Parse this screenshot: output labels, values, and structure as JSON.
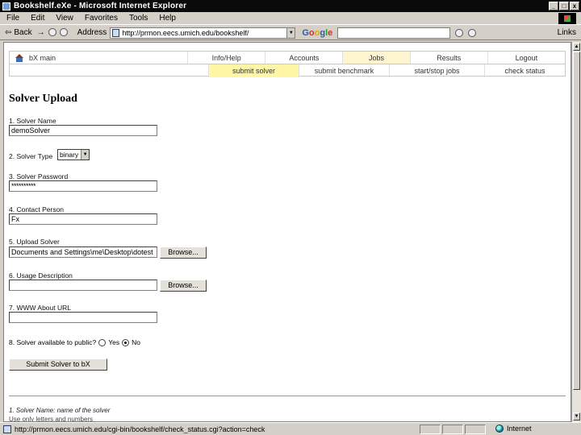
{
  "window": {
    "title": "Bookshelf.eXe - Microsoft Internet Explorer",
    "buttons": [
      "_",
      "□",
      "x"
    ]
  },
  "menubar": [
    "File",
    "Edit",
    "View",
    "Favorites",
    "Tools",
    "Help"
  ],
  "toolbar": {
    "back_label": "Back",
    "address_label": "Address",
    "address_value": "http://prmon.eecs.umich.edu/bookshelf/",
    "search_brand": "Google",
    "links_label": "Links"
  },
  "nav": {
    "home_label": "bX  main",
    "top_items": [
      "Info/Help",
      "Accounts",
      "Jobs",
      "Results",
      "Logout"
    ],
    "active_top": "Jobs",
    "sub_items": [
      "submit solver",
      "submit benchmark",
      "start/stop jobs",
      "check status"
    ],
    "active_sub": "submit solver"
  },
  "form": {
    "title": "Solver Upload",
    "fields": {
      "name_label": "1. Solver Name",
      "name_value": "demoSolver",
      "type_label": "2. Solver Type",
      "type_value": "binary",
      "password_label": "3. Solver Password",
      "password_value": "**********",
      "contact_label": "4. Contact Person",
      "contact_value": "Fx",
      "upload_label": "5. Upload Solver",
      "upload_value": "Documents and Settings\\me\\Desktop\\dotest",
      "usage_label": "6. Usage Description",
      "usage_value": "",
      "url_label": "7. WWW About URL",
      "url_value": "",
      "public_label": "8. Solver available to public?",
      "yes_label": "Yes",
      "no_label": "No"
    },
    "browse_label": "Browse...",
    "submit_label": "Submit Solver to bX",
    "footnote": "1. Solver Name: name of the solver",
    "footnote2": "   Use only letters and numbers"
  },
  "statusbar": {
    "text": "http://prmon.eecs.umich.edu/cgi-bin/bookshelf/check_status.cgi?action=check",
    "zone": "Internet"
  }
}
